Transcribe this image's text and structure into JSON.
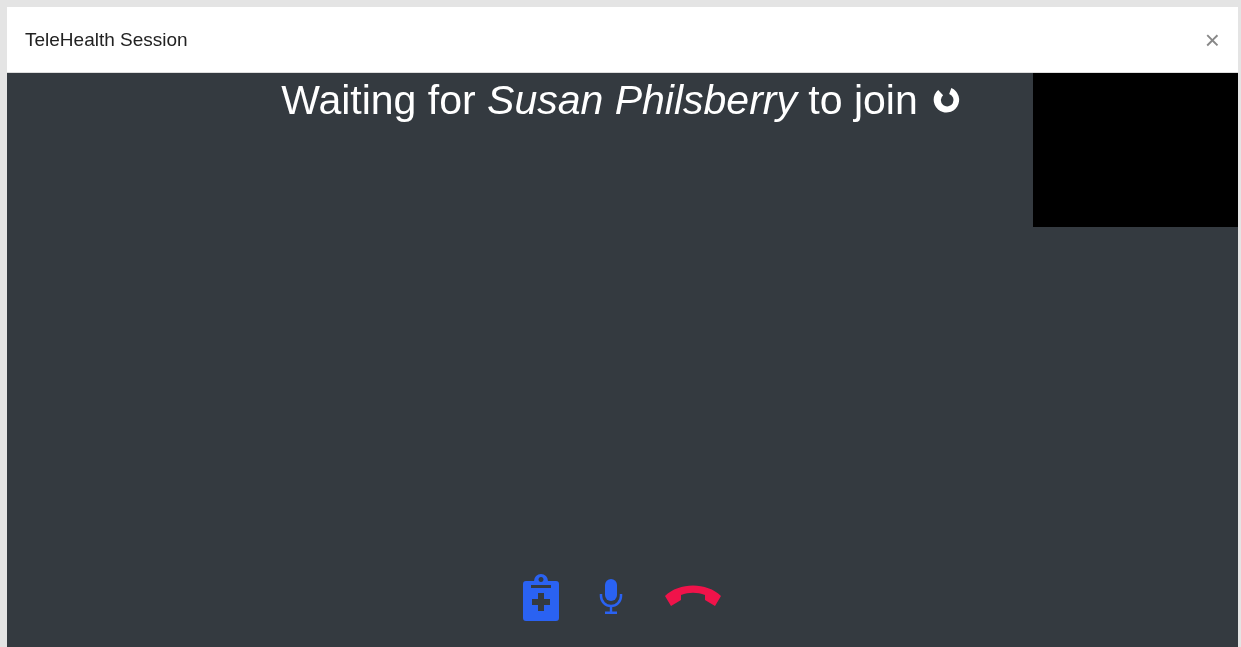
{
  "window": {
    "title": "TeleHealth Session",
    "close": "×"
  },
  "session": {
    "status": "Waiting for *Susan Philsberry* to join",
    "waiting": true
  },
  "controls": [
    {
      "kind": "notes"
    },
    {
      "kind": "mic"
    },
    {
      "kind": "hangup"
    }
  ]
}
